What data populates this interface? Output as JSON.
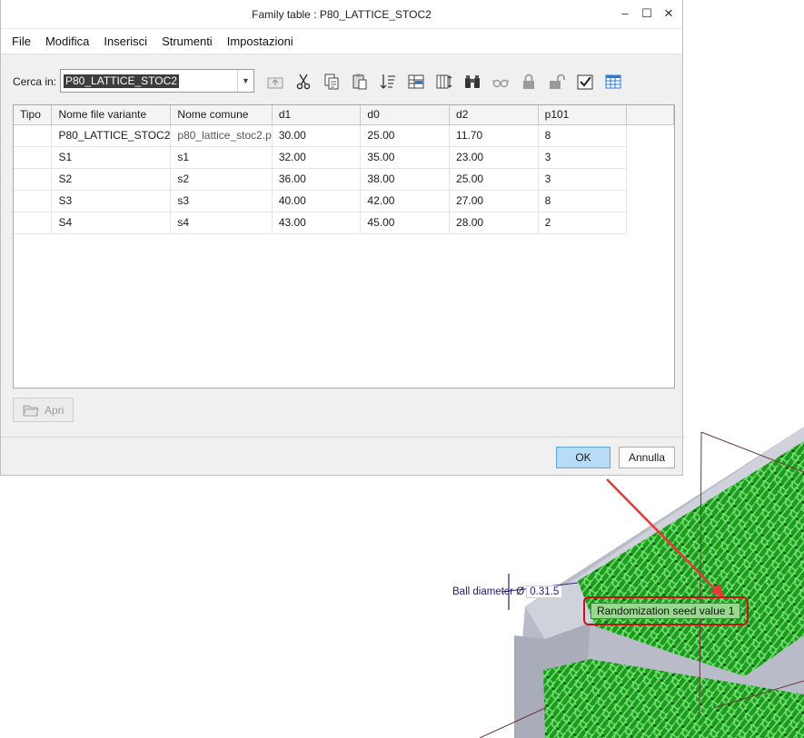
{
  "window": {
    "title": "Family table : P80_LATTICE_STOC2",
    "controls": [
      "–",
      "☐",
      "✕"
    ]
  },
  "menu": [
    "File",
    "Modifica",
    "Inserisci",
    "Strumenti",
    "Impostazioni"
  ],
  "search": {
    "label": "Cerca in:",
    "value": "P80_LATTICE_STOC2"
  },
  "toolbar_icons": [
    "folder-up-icon",
    "cut-icon",
    "copy-icon",
    "paste-icon",
    "sort-icon",
    "insert-column-icon",
    "column-settings-icon",
    "binoculars-icon",
    "glasses-icon",
    "lock-icon",
    "unlock-icon",
    "verify-icon",
    "table-view-icon"
  ],
  "table": {
    "columns": [
      "Tipo",
      "Nome file variante",
      "Nome comune",
      "d1",
      "d0",
      "d2",
      "p101"
    ],
    "rows": [
      [
        "",
        "P80_LATTICE_STOC2",
        "p80_lattice_stoc2.p",
        "30.00",
        "25.00",
        "11.70",
        "8"
      ],
      [
        "",
        "S1",
        "s1",
        "32.00",
        "35.00",
        "23.00",
        "3"
      ],
      [
        "",
        "S2",
        "s2",
        "36.00",
        "38.00",
        "25.00",
        "3"
      ],
      [
        "",
        "S3",
        "s3",
        "40.00",
        "42.00",
        "27.00",
        "8"
      ],
      [
        "",
        "S4",
        "s4",
        "43.00",
        "45.00",
        "28.00",
        "2"
      ]
    ]
  },
  "buttons": {
    "open": "Apri",
    "ok": "OK",
    "cancel": "Annulla"
  },
  "scene": {
    "ball_label": "Ball diameter Ø",
    "ball_value": "0.31.5",
    "seed_label": "Randomization seed value 1"
  },
  "colors": {
    "ok_button": "#b8dcf7",
    "lattice_green": "#22b422",
    "highlight_red": "#c8121b",
    "seed_label_bg": "#98d98e"
  }
}
